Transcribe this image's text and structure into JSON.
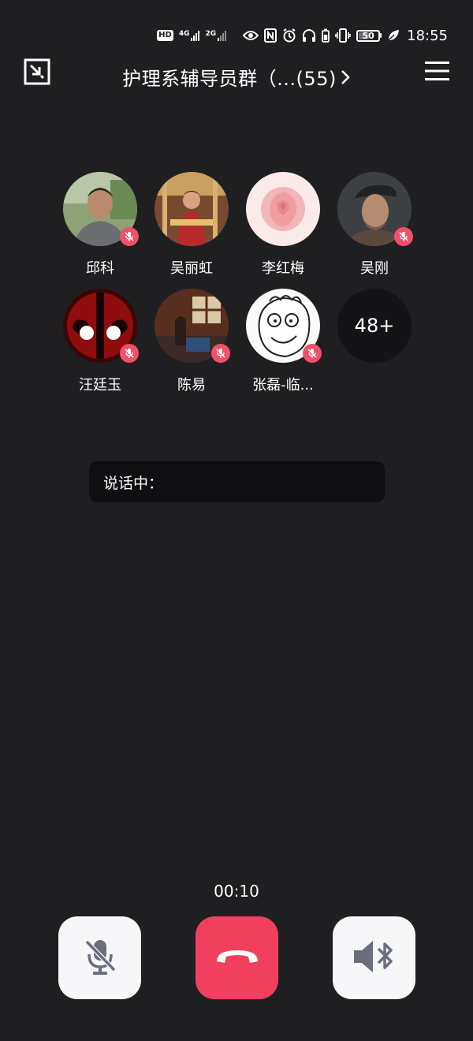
{
  "status_bar": {
    "hd_label": "HD",
    "net1_label": "4G",
    "net2_label": "2G",
    "battery_level": "50",
    "time": "18:55",
    "icons": [
      "hd-icon",
      "signal-4g-icon",
      "signal-2g-icon",
      "eye-icon",
      "nfc-icon",
      "alarm-icon",
      "headphones-icon",
      "battery-saver-icon",
      "vibrate-icon",
      "battery-icon",
      "leaf-icon"
    ]
  },
  "header": {
    "title": "护理系辅导员群（...(55)",
    "minimize_icon": "minimize-window-icon",
    "menu_icon": "hamburger-menu-icon"
  },
  "participants": [
    {
      "name": "邱科",
      "muted": true,
      "avatar": "photo-man-outdoor"
    },
    {
      "name": "吴丽虹",
      "muted": false,
      "avatar": "photo-child-carousel"
    },
    {
      "name": "李红梅",
      "muted": false,
      "avatar": "photo-pink-rose"
    },
    {
      "name": "吴刚",
      "muted": true,
      "avatar": "photo-soldier-beret"
    },
    {
      "name": "汪廷玉",
      "muted": true,
      "avatar": "deadpool-mask"
    },
    {
      "name": "陈易",
      "muted": true,
      "avatar": "photo-room-piano"
    },
    {
      "name": "张磊-临...",
      "muted": true,
      "avatar": "cartoon-face"
    }
  ],
  "more_count": "48+",
  "speaking": {
    "label": "说话中："
  },
  "call": {
    "timer": "00:10"
  },
  "controls": {
    "mic_icon": "mic-off-icon",
    "hangup_icon": "hang-up-icon",
    "speaker_icon": "bluetooth-speaker-icon"
  },
  "colors": {
    "background": "#1f1f21",
    "mute_badge": "#f0506a",
    "hangup": "#f13f5e",
    "button_light": "#f7f7f9"
  }
}
